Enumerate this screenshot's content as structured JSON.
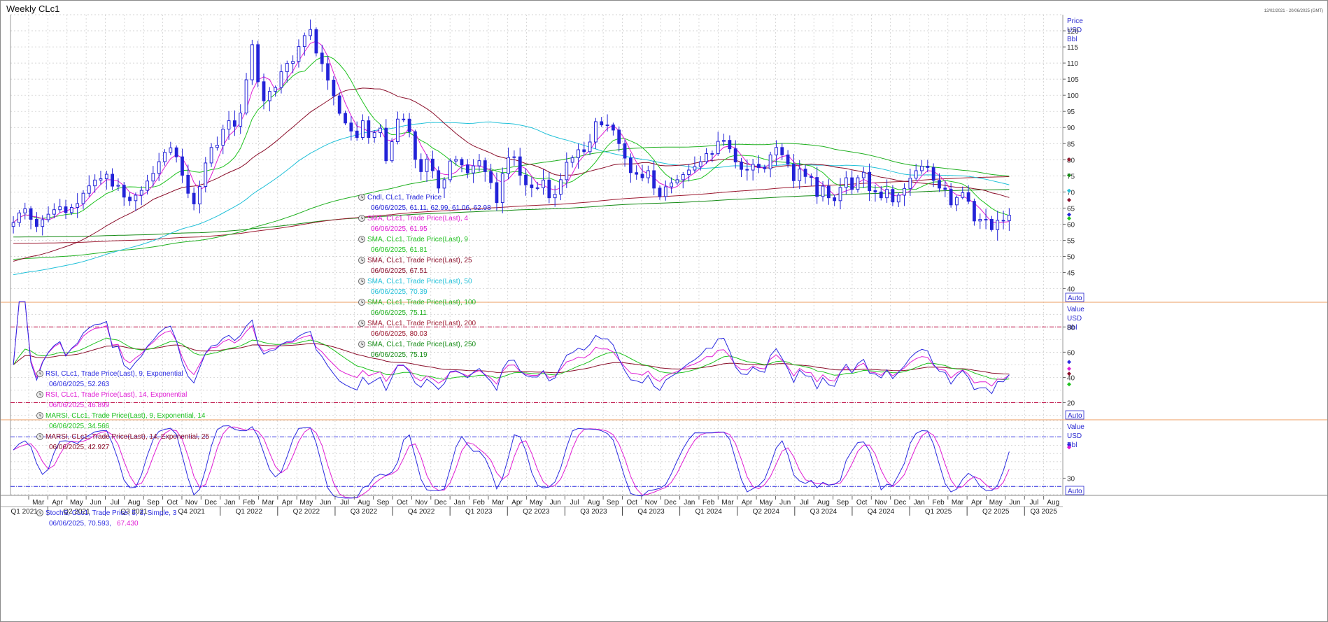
{
  "window": {
    "title": "Weekly CLc1",
    "date_range": "12/02/2021 - 20/06/2025 (GMT)",
    "auto_label": "Auto"
  },
  "colors": {
    "candle": "#2323d8",
    "sma4": "#e01cd4",
    "sma9": "#1fc21f",
    "sma25": "#8a0e2a",
    "sma50": "#20c0d8",
    "sma100": "#20b020",
    "sma200": "#9c1a30",
    "sma250": "#138a13",
    "rsi9": "#2a2ae0",
    "rsi14": "#e01cd4",
    "marsi9": "#1fc21f",
    "marsi14": "#8a0e2a",
    "stoch_k": "#2a2ae0",
    "stoch_d": "#e01cd4",
    "grid": "#c8c8c8",
    "refline": "#c0144a",
    "stochref": "#2a2ae0"
  },
  "chart_data": [
    {
      "type": "candlestick",
      "panel": "price",
      "axis_label": [
        "Price",
        "USD",
        "Bbl"
      ],
      "ylim": [
        36,
        125
      ],
      "y_ticks": [
        40,
        45,
        50,
        55,
        60,
        65,
        70,
        75,
        80,
        85,
        90,
        95,
        100,
        105,
        110,
        115,
        120
      ],
      "x_months": [
        "Mar",
        "Apr",
        "May",
        "Jun",
        "Jul",
        "Aug",
        "Sep",
        "Oct",
        "Nov",
        "Dec",
        "Jan",
        "Feb",
        "Mar",
        "Apr",
        "May",
        "Jun",
        "Jul",
        "Aug",
        "Sep",
        "Oct",
        "Nov",
        "Dec",
        "Jan",
        "Feb",
        "Mar",
        "Apr",
        "May",
        "Jun",
        "Jul",
        "Aug",
        "Sep",
        "Oct",
        "Nov",
        "Dec",
        "Jan",
        "Feb",
        "Mar",
        "Apr",
        "May",
        "Jun",
        "Jul",
        "Aug",
        "Sep",
        "Oct",
        "Nov",
        "Dec",
        "Jan",
        "Feb",
        "Mar",
        "Apr",
        "May",
        "Jun",
        "Jul",
        "Aug"
      ],
      "x_quarters": [
        "Q1 2021",
        "Q2 2021",
        "Q3 2021",
        "Q4 2021",
        "Q1 2022",
        "Q2 2022",
        "Q3 2022",
        "Q4 2022",
        "Q1 2023",
        "Q2 2023",
        "Q3 2023",
        "Q4 2023",
        "Q1 2024",
        "Q2 2024",
        "Q3 2024",
        "Q4 2024",
        "Q1 2025",
        "Q2 2025",
        "Q3 2025"
      ],
      "close": [
        60.5,
        63.5,
        64.8,
        61.5,
        59.3,
        61.4,
        63.1,
        64.5,
        65.4,
        63.6,
        65.2,
        66.4,
        69.6,
        71.9,
        73.7,
        74.1,
        75.5,
        71.8,
        72.1,
        68.4,
        67.3,
        69.0,
        70.5,
        73.4,
        75.8,
        79.4,
        82.3,
        83.7,
        80.9,
        75.2,
        69.6,
        66.3,
        71.7,
        79.0,
        83.8,
        84.5,
        89.5,
        92.1,
        90.4,
        94.5,
        104.8,
        115.7,
        104.2,
        98.3,
        101.2,
        102.4,
        107.3,
        109.9,
        110.5,
        115.1,
        118.5,
        120.4,
        113.1,
        109.8,
        104.7,
        99.8,
        94.4,
        91.4,
        88.9,
        86.9,
        92.1,
        86.9,
        88.4,
        89.8,
        79.7,
        85.6,
        92.6,
        92.6,
        88.7,
        80.1,
        76.3,
        80.2,
        76.6,
        71.2,
        73.8,
        79.6,
        80.1,
        78.4,
        75.9,
        78.1,
        79.7,
        76.3,
        72.9,
        66.7,
        75.7,
        80.7,
        80.9,
        75.2,
        72.2,
        71.3,
        71.3,
        73.7,
        68.2,
        69.3,
        73.8,
        79.2,
        80.6,
        83.1,
        82.5,
        85.5,
        91.8,
        90.8,
        90.8,
        89.2,
        85.0,
        80.5,
        76.0,
        75.5,
        74.4,
        76.6,
        71.2,
        68.6,
        71.6,
        72.8,
        73.8,
        75.4,
        76.8,
        77.9,
        79.4,
        81.9,
        81.9,
        85.7,
        86.0,
        83.4,
        79.3,
        77.0,
        76.8,
        78.6,
        77.6,
        77.2,
        81.5,
        83.8,
        81.5,
        78.6,
        73.5,
        77.1,
        74.8,
        74.5,
        68.6,
        71.8,
        68.2,
        67.3,
        71.4,
        74.4,
        70.8,
        74.4,
        76.1,
        70.4,
        70.0,
        68.2,
        70.8,
        66.9,
        69.0,
        71.1,
        74.3,
        76.6,
        78.0,
        77.6,
        73.6,
        71.2,
        70.8,
        66.0,
        68.3,
        69.8,
        67.1,
        61.0,
        61.5,
        61.5,
        58.3,
        61.2,
        61.1,
        62.8
      ],
      "sma": {
        "4": {
          "date": "06/06/2025",
          "value": 61.95
        },
        "9": {
          "date": "06/06/2025",
          "value": 61.81
        },
        "25": {
          "date": "06/06/2025",
          "value": 67.51
        },
        "50": {
          "date": "06/06/2025",
          "value": 70.39
        },
        "100": {
          "date": "06/06/2025",
          "value": 75.11
        },
        "200": {
          "date": "06/06/2025",
          "value": 80.03
        },
        "250": {
          "date": "06/06/2025",
          "value": 75.19
        }
      }
    },
    {
      "type": "line",
      "panel": "rsi",
      "axis_label": [
        "Value",
        "USD",
        "Bbl"
      ],
      "ylim": [
        7,
        99
      ],
      "y_ticks": [
        20,
        40,
        60,
        80
      ],
      "reference_lines": [
        20,
        80
      ],
      "series_names": [
        "RSI 9",
        "RSI 14",
        "MARSI 9",
        "MARSI 14"
      ]
    },
    {
      "type": "line",
      "panel": "stochastic",
      "axis_label": [
        "Value",
        "USD",
        "Bbl"
      ],
      "ylim": [
        10,
        100
      ],
      "y_ticks": [
        30
      ],
      "reference_lines": [
        20,
        80
      ],
      "series_names": [
        "%K",
        "%D"
      ]
    }
  ],
  "legend": {
    "price": [
      {
        "label": "Cndl, CLc1, Trade Price",
        "value": "06/06/2025, 61.11, 62.99, 61.06, 62.98",
        "color": "#2323d8"
      },
      {
        "label": "SMA, CLc1, Trade Price(Last),  4",
        "value": "06/06/2025, 61.95",
        "color": "#e01cd4"
      },
      {
        "label": "SMA, CLc1, Trade Price(Last),  9",
        "value": "06/06/2025, 61.81",
        "color": "#1fc21f"
      },
      {
        "label": "SMA, CLc1, Trade Price(Last),  25",
        "value": "06/06/2025, 67.51",
        "color": "#8a0e2a"
      },
      {
        "label": "SMA, CLc1, Trade Price(Last),  50",
        "value": "06/06/2025, 70.39",
        "color": "#20c0d8"
      },
      {
        "label": "SMA, CLc1, Trade Price(Last),  100",
        "value": "06/06/2025, 75.11",
        "color": "#20b020"
      },
      {
        "label": "SMA, CLc1, Trade Price(Last),  200",
        "value": "06/06/2025, 80.03",
        "color": "#9c1a30"
      },
      {
        "label": "SMA, CLc1, Trade Price(Last),  250",
        "value": "06/06/2025, 75.19",
        "color": "#138a13"
      }
    ],
    "rsi": [
      {
        "label": "RSI, CLc1, Trade Price(Last),  9, Exponential",
        "value": "06/06/2025, 52.263",
        "color": "#2a2ae0"
      },
      {
        "label": "RSI, CLc1, Trade Price(Last),  14, Exponential",
        "value": "06/06/2025, 46.899",
        "color": "#e01cd4"
      },
      {
        "label": "MARSI, CLc1, Trade Price(Last),  9, Exponential, 14",
        "value": "06/06/2025, 34.566",
        "color": "#1fc21f"
      },
      {
        "label": "MARSI, CLc1, Trade Price(Last),  14, Exponential, 25",
        "value": "06/06/2025, 42.927",
        "color": "#8a0e2a"
      }
    ],
    "stoch": {
      "label": "StochS, CLc1, Trade Price,  5, 3, Simple, 3",
      "value_k": "06/06/2025, 70.593,",
      "value_d": "67.430",
      "color_k": "#2a2ae0",
      "color_d": "#e01cd4"
    }
  }
}
